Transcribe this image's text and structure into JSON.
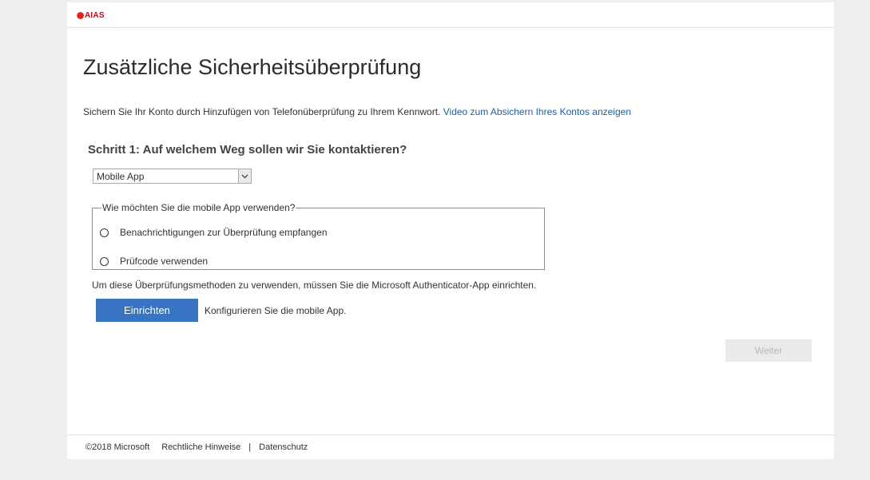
{
  "header": {
    "logo_text": "AIAS"
  },
  "main": {
    "title": "Zusätzliche Sicherheitsüberprüfung",
    "intro_text": "Sichern Sie Ihr Konto durch Hinzufügen von Telefonüberprüfung zu Ihrem Kennwort.",
    "intro_link": "Video zum Absichern Ihres Kontos anzeigen",
    "step_title": "Schritt 1: Auf welchem Weg sollen wir Sie kontaktieren?",
    "contact_method": {
      "selected": "Mobile App"
    },
    "app_usage": {
      "legend": "Wie möchten Sie die mobile App verwenden?",
      "options": [
        {
          "label": "Benachrichtigungen zur Überprüfung empfangen",
          "checked": false
        },
        {
          "label": "Prüfcode verwenden",
          "checked": false
        }
      ]
    },
    "setup_hint": "Um diese Überprüfungsmethoden zu verwenden, müssen Sie die Microsoft Authenticator-App einrichten.",
    "setup_button": "Einrichten",
    "setup_note": "Konfigurieren Sie die mobile App.",
    "next_button": "Weiter"
  },
  "footer": {
    "copyright": "©2018 Microsoft",
    "legal_link": "Rechtliche Hinweise",
    "separator": "|",
    "privacy_link": "Datenschutz"
  },
  "colors": {
    "primary_button": "#3874c1",
    "link": "#1f5f9b",
    "logo": "#d0021b",
    "disabled_button": "#eaeaea"
  }
}
